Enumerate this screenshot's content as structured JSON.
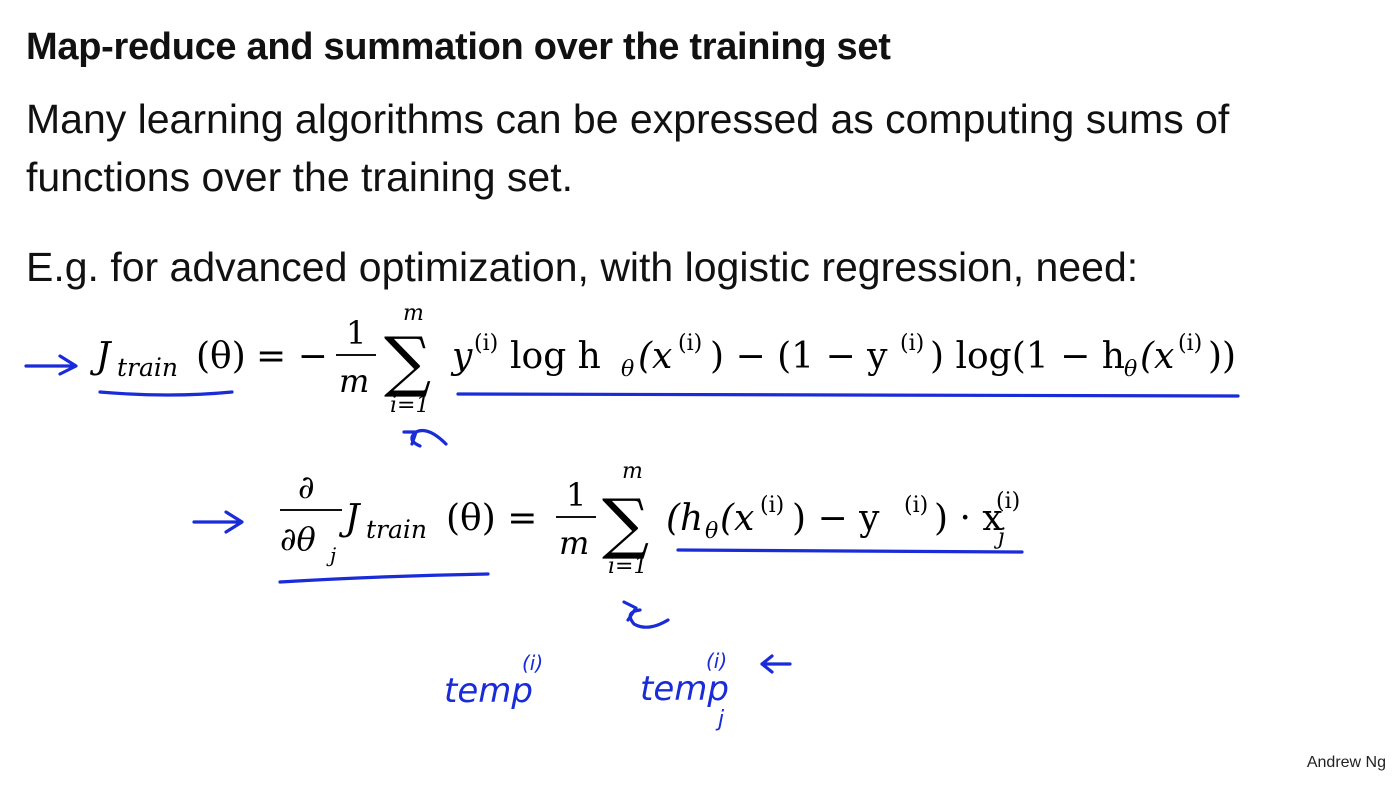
{
  "slide": {
    "title": "Map-reduce and summation over the training set",
    "intro": "Many learning algorithms can be expressed as computing sums of functions over the training set.",
    "example": "E.g. for advanced optimization, with logistic regression, need:",
    "author": "Andrew Ng"
  },
  "equation_cost": {
    "J": "J",
    "J_sub": "train",
    "theta_arg": "(θ)",
    "equals": "= −",
    "frac_num": "1",
    "frac_den": "m",
    "sum_symbol": "∑",
    "sum_upper": "m",
    "sum_lower": "i=1",
    "y": "y",
    "sup_i": "(i)",
    "log_h": " log h",
    "theta_sub": "θ",
    "x_open": "(x",
    "minus_one": ") − (1 − y",
    "log_one_minus_h": ") log(1 − h",
    "close_paren": "))"
  },
  "equation_grad": {
    "partial_num": "∂",
    "partial_den": "∂θ",
    "j_sub": "j",
    "J": "J",
    "J_sub": "train",
    "theta_arg": "(θ) =",
    "frac_num": "1",
    "frac_den": "m",
    "sum_symbol": "∑",
    "sum_upper": "m",
    "sum_lower": "i=1",
    "h_open": "(h",
    "theta_sub": "θ",
    "x_open": "(x",
    "sup_i": "(i)",
    "minus_y": ") − y",
    "dot_x": ") · x",
    "x_sub": "j"
  },
  "annotations": {
    "temp_left": "temp",
    "temp_left_sup": "(i)",
    "temp_right": "temp",
    "temp_right_sup": "(i)",
    "temp_right_sub": "j",
    "ink_color": "#1a2bd8"
  }
}
